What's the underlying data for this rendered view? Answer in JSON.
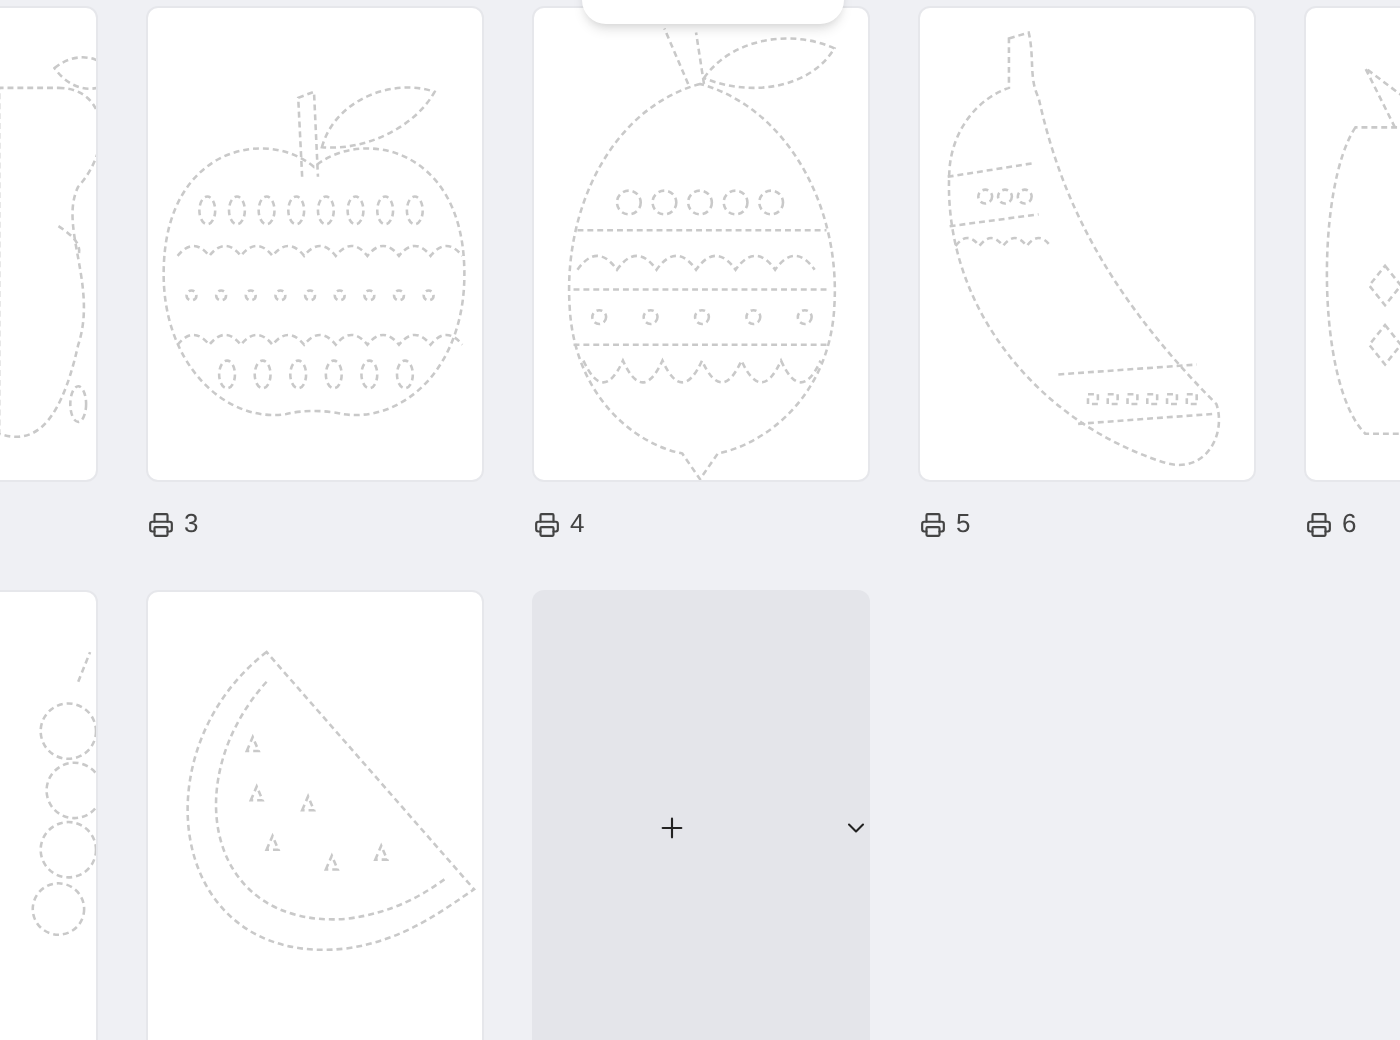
{
  "pages": [
    {
      "kind": "pear"
    },
    {
      "kind": "apple",
      "number": "3"
    },
    {
      "kind": "lemon",
      "number": "4"
    },
    {
      "kind": "banana",
      "number": "5"
    },
    {
      "kind": "pineapple",
      "number": "6"
    },
    {
      "kind": "grapes"
    },
    {
      "kind": "watermelon"
    },
    {
      "kind": "add"
    }
  ]
}
